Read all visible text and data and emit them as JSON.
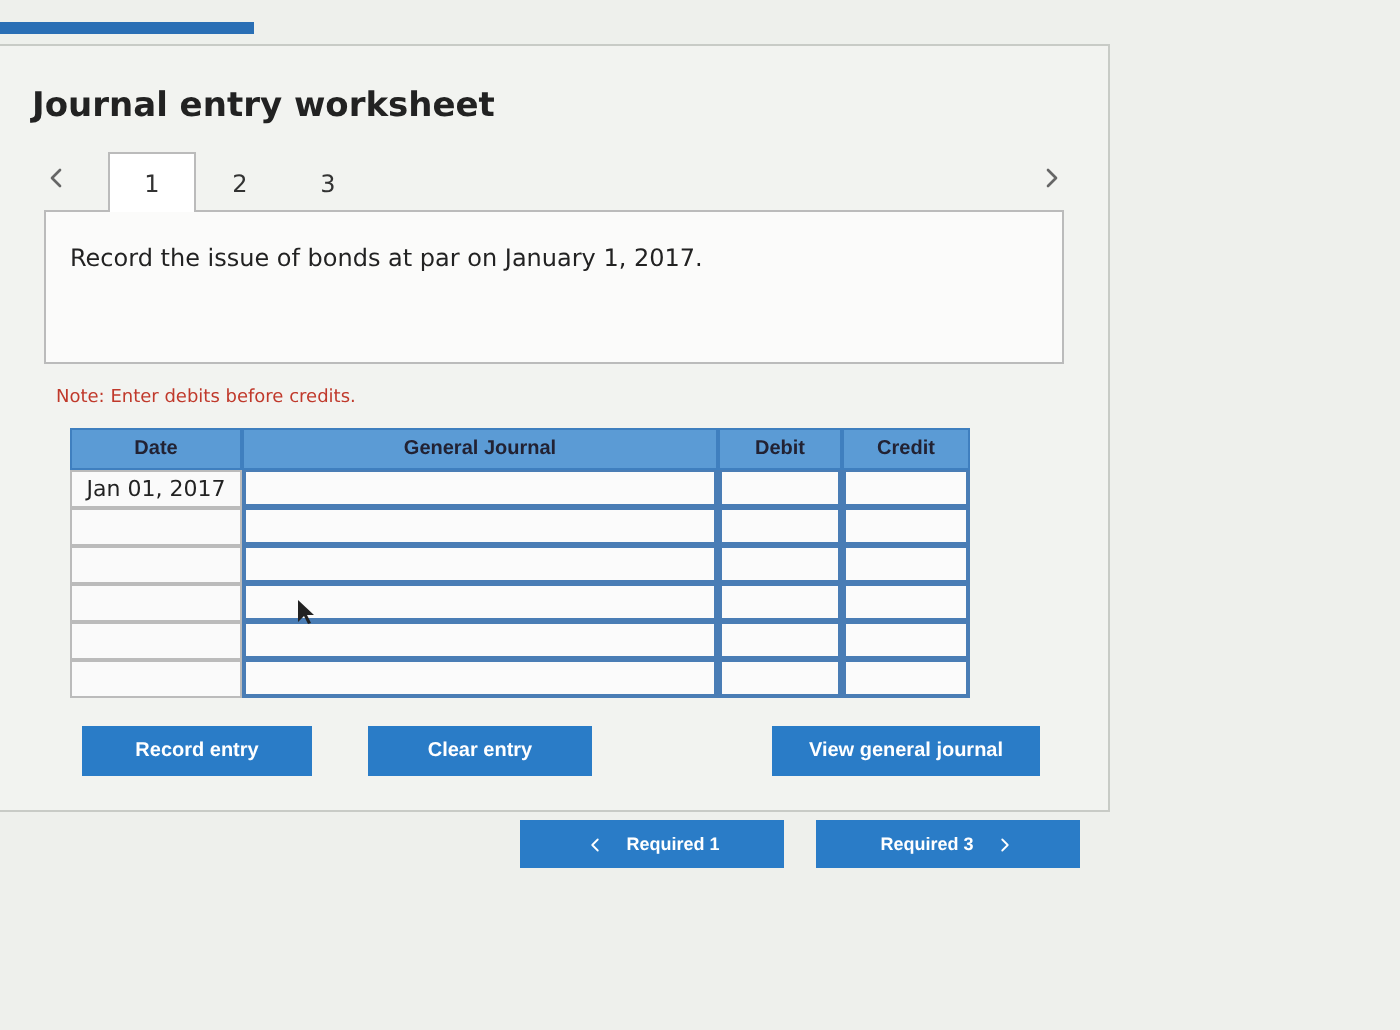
{
  "title": "Journal entry worksheet",
  "tabs": [
    {
      "label": "1",
      "selected": true
    },
    {
      "label": "2",
      "selected": false
    },
    {
      "label": "3",
      "selected": false
    }
  ],
  "prompt": "Record the issue of bonds at par on January 1, 2017.",
  "note": "Note: Enter debits before credits.",
  "table": {
    "columns": [
      "Date",
      "General Journal",
      "Debit",
      "Credit"
    ],
    "rows": [
      {
        "date": "Jan 01, 2017"
      },
      {},
      {},
      {},
      {},
      {}
    ]
  },
  "buttons": [
    "Record entry",
    "Clear entry",
    "View general journal"
  ],
  "nav": {
    "previous": "Required 1",
    "next": "Required 3"
  }
}
